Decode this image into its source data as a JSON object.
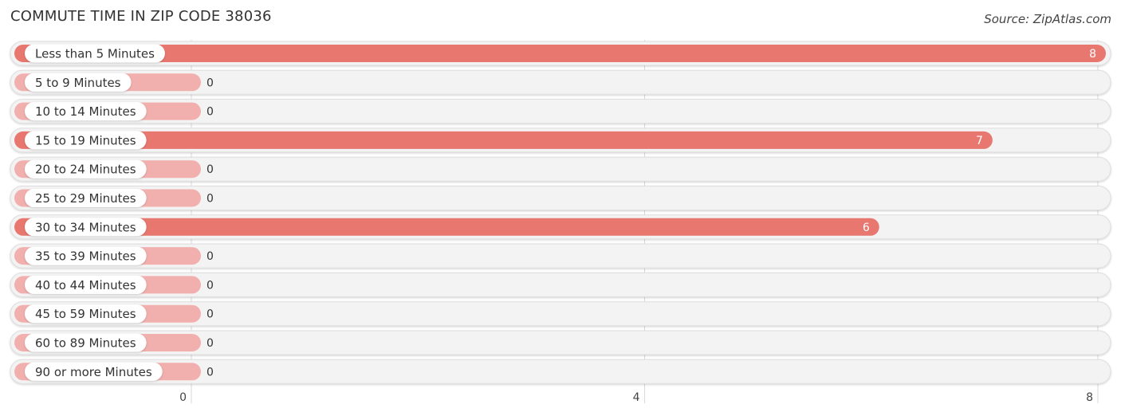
{
  "header": {
    "title": "COMMUTE TIME IN ZIP CODE 38036",
    "source": "Source: ZipAtlas.com"
  },
  "colors": {
    "bar_strong": "#e8776f",
    "bar_weak": "#f1b0ae",
    "track": "#f3f3f3",
    "grid": "#d9d9d9"
  },
  "chart_data": {
    "type": "bar",
    "orientation": "horizontal",
    "title": "COMMUTE TIME IN ZIP CODE 38036",
    "xlabel": "",
    "ylabel": "",
    "categories": [
      "Less than 5 Minutes",
      "5 to 9 Minutes",
      "10 to 14 Minutes",
      "15 to 19 Minutes",
      "20 to 24 Minutes",
      "25 to 29 Minutes",
      "30 to 34 Minutes",
      "35 to 39 Minutes",
      "40 to 44 Minutes",
      "45 to 59 Minutes",
      "60 to 89 Minutes",
      "90 or more Minutes"
    ],
    "values": [
      8,
      0,
      0,
      7,
      0,
      0,
      6,
      0,
      0,
      0,
      0,
      0
    ],
    "xlim": [
      0,
      8
    ],
    "xticks": [
      "0",
      "4",
      "8"
    ],
    "grid": true
  }
}
